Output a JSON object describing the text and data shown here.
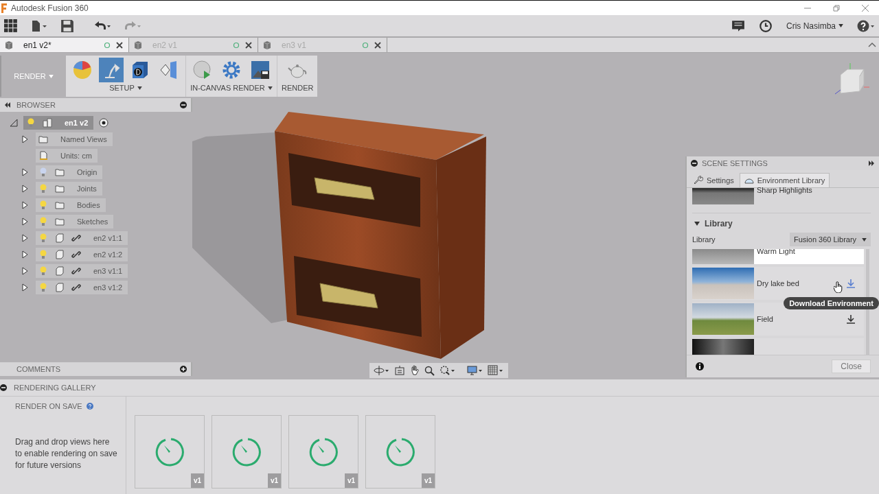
{
  "window": {
    "title": "Autodesk Fusion 360"
  },
  "toolbar": {
    "user": "Cris Nasimba"
  },
  "document_tabs": [
    {
      "label": "en1 v2*",
      "selected": true
    },
    {
      "label": "en2 v1",
      "selected": false
    },
    {
      "label": "en3 v1",
      "selected": false
    }
  ],
  "ribbon": {
    "workspace": "RENDER",
    "groups": [
      {
        "label": "SETUP",
        "menu": true,
        "tools": [
          {
            "kind": "appearance",
            "selected": false
          },
          {
            "kind": "scene",
            "selected": true
          },
          {
            "kind": "decal",
            "selected": false
          },
          {
            "kind": "texture",
            "selected": false
          }
        ]
      },
      {
        "label": "IN-CANVAS RENDER",
        "menu": true,
        "tools": [
          {
            "kind": "play",
            "selected": false
          },
          {
            "kind": "gear",
            "selected": false
          },
          {
            "kind": "capture",
            "selected": false
          }
        ]
      },
      {
        "label": "RENDER",
        "menu": false,
        "tools": [
          {
            "kind": "teapot",
            "selected": false
          }
        ]
      }
    ]
  },
  "browser": {
    "title": "BROWSER",
    "root": {
      "label": "en1 v2",
      "visible": true,
      "selected": true
    },
    "items": [
      {
        "label": "Named Views",
        "expandable": true,
        "kind": "views-folder",
        "selected": false
      },
      {
        "label": "Units: cm",
        "expandable": false,
        "kind": "units",
        "selected": false
      },
      {
        "label": "Origin",
        "expandable": true,
        "visible": false,
        "kind": "folder",
        "selected": false
      },
      {
        "label": "Joints",
        "expandable": true,
        "visible": true,
        "kind": "folder",
        "selected": false
      },
      {
        "label": "Bodies",
        "expandable": true,
        "visible": true,
        "kind": "folder",
        "selected": false
      },
      {
        "label": "Sketches",
        "expandable": true,
        "visible": true,
        "kind": "folder",
        "selected": false
      },
      {
        "label": "en2 v1:1",
        "expandable": true,
        "visible": true,
        "kind": "linked-component",
        "selected": false
      },
      {
        "label": "en2 v1:2",
        "expandable": true,
        "visible": true,
        "kind": "linked-component",
        "selected": false
      },
      {
        "label": "en3 v1:1",
        "expandable": true,
        "visible": true,
        "kind": "linked-component",
        "selected": false
      },
      {
        "label": "en3 v1:2",
        "expandable": true,
        "visible": true,
        "kind": "linked-component",
        "selected": false
      }
    ]
  },
  "comments": {
    "title": "COMMENTS"
  },
  "scene_settings": {
    "title": "SCENE SETTINGS",
    "tabs": [
      {
        "label": "Settings",
        "selected": false
      },
      {
        "label": "Environment Library",
        "selected": true
      }
    ],
    "current_environment": "Sharp Highlights",
    "section": "Library",
    "library_label": "Library",
    "library_select": "Fusion 360 Library",
    "environments": [
      {
        "name": "Warm Light",
        "kind": "gray",
        "selected": true,
        "download": false,
        "hovered": false
      },
      {
        "name": "Dry lake bed",
        "kind": "lake",
        "selected": false,
        "download": true,
        "hovered": true
      },
      {
        "name": "Field",
        "kind": "field",
        "selected": false,
        "download": true,
        "hovered": false
      },
      {
        "kind": "dark",
        "selected": false,
        "download": false,
        "hovered": false
      }
    ],
    "tooltip": "Download Environment",
    "close": "Close"
  },
  "rendering_gallery": {
    "title": "RENDERING GALLERY",
    "render_on_save": "RENDER ON SAVE",
    "hint": "Drag and drop views here to enable rendering on save for future versions",
    "renders": [
      {
        "version": "v1"
      },
      {
        "version": "v1"
      },
      {
        "version": "v1"
      },
      {
        "version": "v1"
      }
    ]
  }
}
